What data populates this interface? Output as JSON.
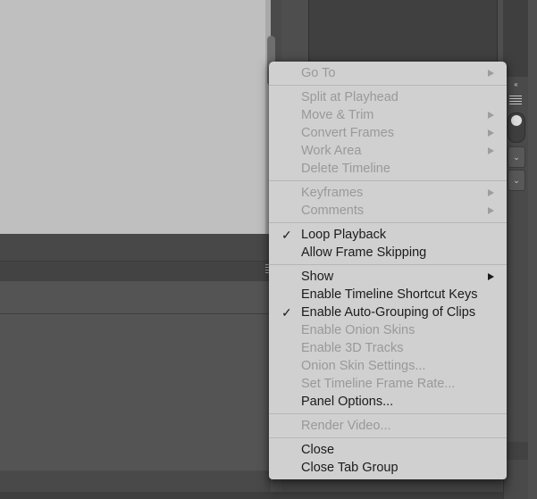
{
  "background": {
    "canvas_label": "",
    "hamburger_icon": "hamburger-icon",
    "rail": {
      "collapse_label": "«",
      "menu_icon": "hamburger-icon",
      "toggle_icon": "toggle-knob-icon",
      "chevron_label": "⌄"
    }
  },
  "context_menu": {
    "groups": [
      {
        "items": [
          {
            "label": "Go To",
            "disabled": true,
            "checked": false,
            "submenu": true
          }
        ]
      },
      {
        "items": [
          {
            "label": "Split at Playhead",
            "disabled": true,
            "checked": false,
            "submenu": false
          },
          {
            "label": "Move & Trim",
            "disabled": true,
            "checked": false,
            "submenu": true
          },
          {
            "label": "Convert Frames",
            "disabled": true,
            "checked": false,
            "submenu": true
          },
          {
            "label": "Work Area",
            "disabled": true,
            "checked": false,
            "submenu": true
          },
          {
            "label": "Delete Timeline",
            "disabled": true,
            "checked": false,
            "submenu": false
          }
        ]
      },
      {
        "items": [
          {
            "label": "Keyframes",
            "disabled": true,
            "checked": false,
            "submenu": true
          },
          {
            "label": "Comments",
            "disabled": true,
            "checked": false,
            "submenu": true
          }
        ]
      },
      {
        "items": [
          {
            "label": "Loop Playback",
            "disabled": false,
            "checked": true,
            "submenu": false
          },
          {
            "label": "Allow Frame Skipping",
            "disabled": false,
            "checked": false,
            "submenu": false
          }
        ]
      },
      {
        "items": [
          {
            "label": "Show",
            "disabled": false,
            "checked": false,
            "submenu": true
          },
          {
            "label": "Enable Timeline Shortcut Keys",
            "disabled": false,
            "checked": false,
            "submenu": false
          },
          {
            "label": "Enable Auto-Grouping of Clips",
            "disabled": false,
            "checked": true,
            "submenu": false
          },
          {
            "label": "Enable Onion Skins",
            "disabled": true,
            "checked": false,
            "submenu": false
          },
          {
            "label": "Enable 3D Tracks",
            "disabled": true,
            "checked": false,
            "submenu": false
          },
          {
            "label": "Onion Skin Settings...",
            "disabled": true,
            "checked": false,
            "submenu": false
          },
          {
            "label": "Set Timeline Frame Rate...",
            "disabled": true,
            "checked": false,
            "submenu": false
          },
          {
            "label": "Panel Options...",
            "disabled": false,
            "checked": false,
            "submenu": false
          }
        ]
      },
      {
        "items": [
          {
            "label": "Render Video...",
            "disabled": true,
            "checked": false,
            "submenu": false
          }
        ]
      },
      {
        "items": [
          {
            "label": "Close",
            "disabled": false,
            "checked": false,
            "submenu": false
          },
          {
            "label": "Close Tab Group",
            "disabled": false,
            "checked": false,
            "submenu": false
          }
        ]
      }
    ],
    "check_glyph": "✓"
  },
  "colors": {
    "menu_background": "#d0d0d0",
    "menu_separator": "#b6b6b6",
    "menu_text": "#1b1b1b",
    "menu_text_disabled": "#999999",
    "app_background": "#525252",
    "canvas": "#bfbfbf"
  }
}
